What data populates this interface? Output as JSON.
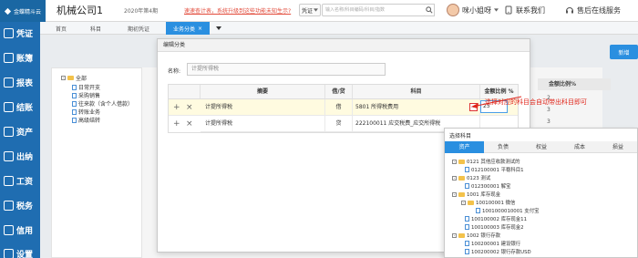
{
  "app": {
    "logo_text": "金蝶精斗云",
    "company": "机械公司1",
    "period": "2020年第4期",
    "notice": "速速查计表，系统升级到这些功能未知生示?",
    "voucher_select": "凭证",
    "search_placeholder": "输入名称/科目编码/科目/指数",
    "user": "咪小姐呀",
    "contact": "联系我们",
    "service": "售后在线服务"
  },
  "sidebar": {
    "items": [
      {
        "label": "凭证",
        "icon": "voucher-icon"
      },
      {
        "label": "账簿",
        "icon": "ledger-icon"
      },
      {
        "label": "报表",
        "icon": "report-icon"
      },
      {
        "label": "结账",
        "icon": "closing-icon"
      },
      {
        "label": "资产",
        "icon": "asset-icon"
      },
      {
        "label": "出纳",
        "icon": "cashier-icon"
      },
      {
        "label": "工资",
        "icon": "salary-icon"
      },
      {
        "label": "税务",
        "icon": "tax-icon"
      },
      {
        "label": "信用",
        "icon": "credit-icon"
      },
      {
        "label": "设置",
        "icon": "settings-icon"
      }
    ],
    "color": "#1f6db1"
  },
  "tabs": [
    {
      "label": "首页",
      "active": false
    },
    {
      "label": "科目",
      "active": false
    },
    {
      "label": "期初凭证",
      "active": false
    },
    {
      "label": "业务分类",
      "active": true,
      "closable": true
    }
  ],
  "background": {
    "new_button": "新增",
    "column_header": "金额比例%",
    "numbers": [
      "2",
      "3",
      "3",
      "2",
      "2",
      "2"
    ],
    "tree": [
      {
        "label": "全部",
        "level": 0
      },
      {
        "label": "日常开支",
        "level": 1
      },
      {
        "label": "采购销售",
        "level": 1
      },
      {
        "label": "往来款（含个人借款）",
        "level": 1
      },
      {
        "label": "转账业务",
        "level": 1
      },
      {
        "label": "高级结转",
        "level": 1
      }
    ]
  },
  "dialog": {
    "title": "编辑分类",
    "name_label": "名称:",
    "name_value": "计提所得税",
    "columns": [
      "摘要",
      "借/贷",
      "科目",
      "金额比例 %"
    ],
    "rows": [
      {
        "summary": "计提所得税",
        "direction": "借",
        "subject": "5801 所得税费用",
        "ratio": "25"
      },
      {
        "summary": "计提所得税",
        "direction": "贷",
        "subject": "222100011 应交税费_应交所得税",
        "ratio": ""
      }
    ]
  },
  "picker": {
    "title": "选择科目",
    "tabs": [
      {
        "label": "资产",
        "active": true
      },
      {
        "label": "负债",
        "active": false
      },
      {
        "label": "权益",
        "active": false
      },
      {
        "label": "成本",
        "active": false
      },
      {
        "label": "损益",
        "active": false
      }
    ],
    "nodes": [
      {
        "label": "0121 其他应收款测试的",
        "type": "folder"
      },
      {
        "label": "012100001 平稳科目1",
        "type": "leaf"
      },
      {
        "label": "0123 测试",
        "type": "folder"
      },
      {
        "label": "012300001 解宝",
        "type": "leaf"
      },
      {
        "label": "1001 库存现金",
        "type": "folder"
      },
      {
        "label": "100100001 微信",
        "type": "folder"
      },
      {
        "label": "1001000010001 支付宝",
        "type": "leaf"
      },
      {
        "label": "100100002 库存现金11",
        "type": "leaf"
      },
      {
        "label": "100100003 库存现金2",
        "type": "leaf"
      },
      {
        "label": "1002 银行存款",
        "type": "folder"
      },
      {
        "label": "100200001 建设银行",
        "type": "leaf"
      },
      {
        "label": "100200002 银行存款USD",
        "type": "leaf"
      }
    ]
  },
  "annotation": {
    "text": "选择对应的科目会自动带出科目即可",
    "color": "#e0261b"
  },
  "colors": {
    "accent": "#2a8fe0",
    "highlight_row": "#fffbe0"
  }
}
